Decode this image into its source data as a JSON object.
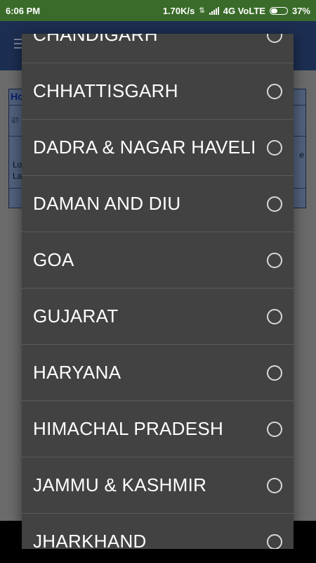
{
  "status_bar": {
    "time": "6:06 PM",
    "net_speed": "1.70K/s",
    "network": "4G VoLTE",
    "battery": "37%",
    "battery_level": 0.37
  },
  "background": {
    "card_title": "Ho",
    "line_a": "রা",
    "line_b": "Lo",
    "line_c": "La",
    "right_fragment": "e"
  },
  "dialog": {
    "items": [
      {
        "label": "CHANDIGARH",
        "selected": false
      },
      {
        "label": "CHHATTISGARH",
        "selected": false
      },
      {
        "label": "DADRA & NAGAR HAVELI",
        "selected": false
      },
      {
        "label": "DAMAN AND DIU",
        "selected": false
      },
      {
        "label": "GOA",
        "selected": false
      },
      {
        "label": "GUJARAT",
        "selected": false
      },
      {
        "label": "HARYANA",
        "selected": false
      },
      {
        "label": "HIMACHAL PRADESH",
        "selected": false
      },
      {
        "label": "JAMMU & KASHMIR",
        "selected": false
      },
      {
        "label": "JHARKHAND",
        "selected": false
      }
    ]
  }
}
